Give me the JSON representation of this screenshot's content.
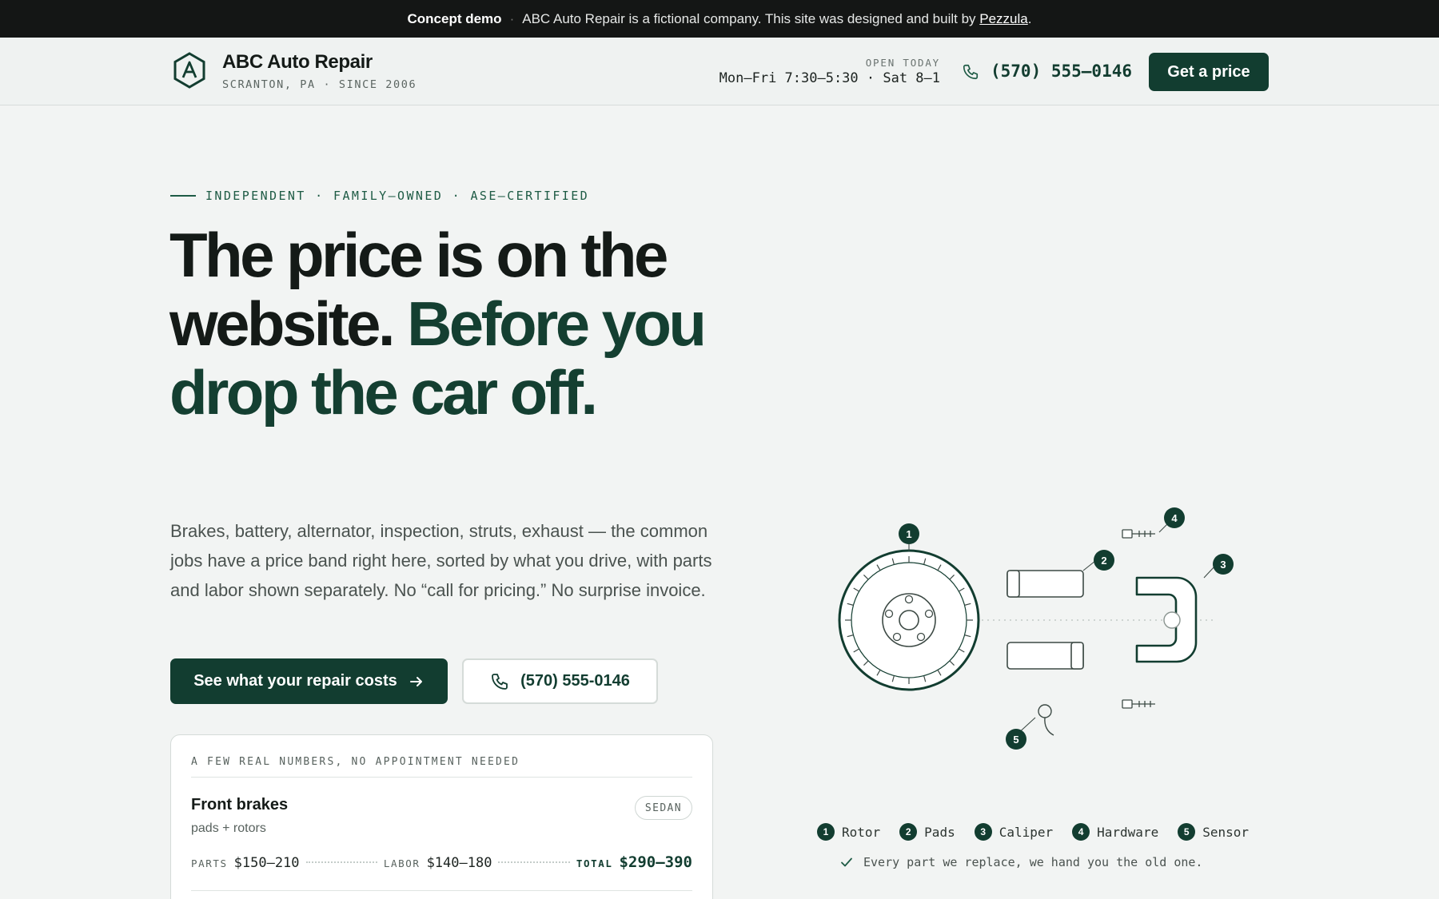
{
  "banner": {
    "label": "Concept demo",
    "separator": "·",
    "text": "ABC Auto Repair is a fictional company. This site was designed and built by",
    "link": "Pezzula",
    "end": "."
  },
  "header": {
    "brand_name": "ABC Auto Repair",
    "brand_sub": "SCRANTON, PA · SINCE 2006",
    "hours_label": "OPEN TODAY",
    "hours_value": "Mon–Fri 7:30–5:30 · Sat 8–1",
    "phone": "(570) 555–0146",
    "cta_label": "Get a price"
  },
  "hero": {
    "eyebrow": "INDEPENDENT · FAMILY–OWNED · ASE–CERTIFIED",
    "title_part1": "The price is on the website.",
    "title_part2": "Before you drop the car off.",
    "lede": "Brakes, battery, alternator, inspection, struts, exhaust — the common jobs have a price band right here, sorted by what you drive, with parts and labor shown separately. No “call for pricing.” No surprise invoice.",
    "primary_cta": "See what your repair costs",
    "secondary_cta": "(570) 555-0146"
  },
  "card": {
    "eyebrow": "A FEW REAL NUMBERS, NO APPOINTMENT NEEDED",
    "job_name": "Front brakes",
    "job_sub": "pads + rotors",
    "badge": "SEDAN",
    "parts_label": "PARTS",
    "parts_value": "$150–210",
    "labor_label": "LABOR",
    "labor_value": "$140–180",
    "total_label": "TOTAL",
    "total_value": "$290–390"
  },
  "illustration": {
    "callouts": [
      "1",
      "2",
      "3",
      "4",
      "5"
    ],
    "legend": [
      {
        "num": "1",
        "label": "Rotor"
      },
      {
        "num": "2",
        "label": "Pads"
      },
      {
        "num": "3",
        "label": "Caliper"
      },
      {
        "num": "4",
        "label": "Hardware"
      },
      {
        "num": "5",
        "label": "Sensor"
      }
    ],
    "promise": "Every part we replace, we hand you the old one."
  },
  "colors": {
    "brand": "#123d30",
    "banner_bg": "#141615",
    "page_bg": "#f2f4f3"
  }
}
